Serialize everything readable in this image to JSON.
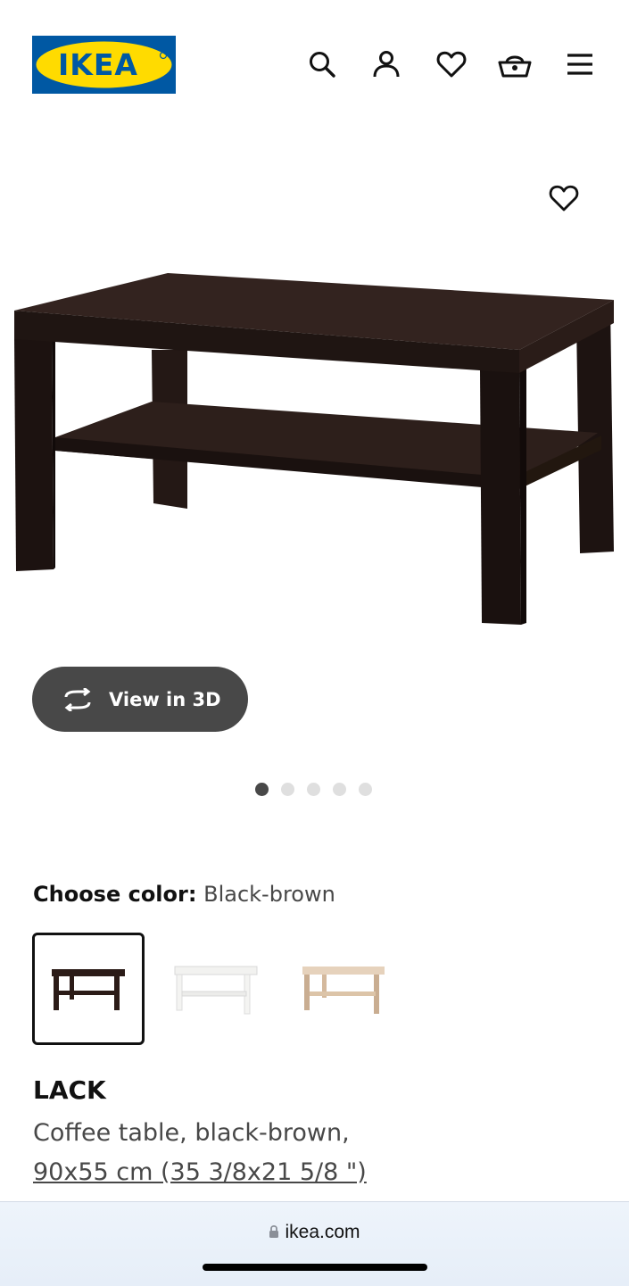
{
  "header": {
    "logo_text": "IKEA",
    "icons": [
      "search-icon",
      "account-icon",
      "heart-icon",
      "basket-icon",
      "menu-icon"
    ]
  },
  "gallery": {
    "favorite_icon": "heart-icon",
    "view_3d_label": "View in 3D",
    "view_3d_icon": "rotate-icon",
    "page_count": 5,
    "active_page": 1
  },
  "color_chooser": {
    "label": "Choose color:",
    "selected_value": "Black-brown",
    "swatch_colors": [
      "#2b1b17",
      "#f2f2f0",
      "#d9c3a8"
    ]
  },
  "product": {
    "name": "LACK",
    "description": "Coffee table, black-brown,",
    "dimensions": "90x55 cm (35 3/8x21 5/8 \")"
  },
  "browser": {
    "url": "ikea.com",
    "lock_icon": "lock-icon"
  },
  "colors": {
    "ikea_blue": "#0058a3",
    "ikea_yellow": "#ffdb00",
    "button_dark": "#484848"
  }
}
